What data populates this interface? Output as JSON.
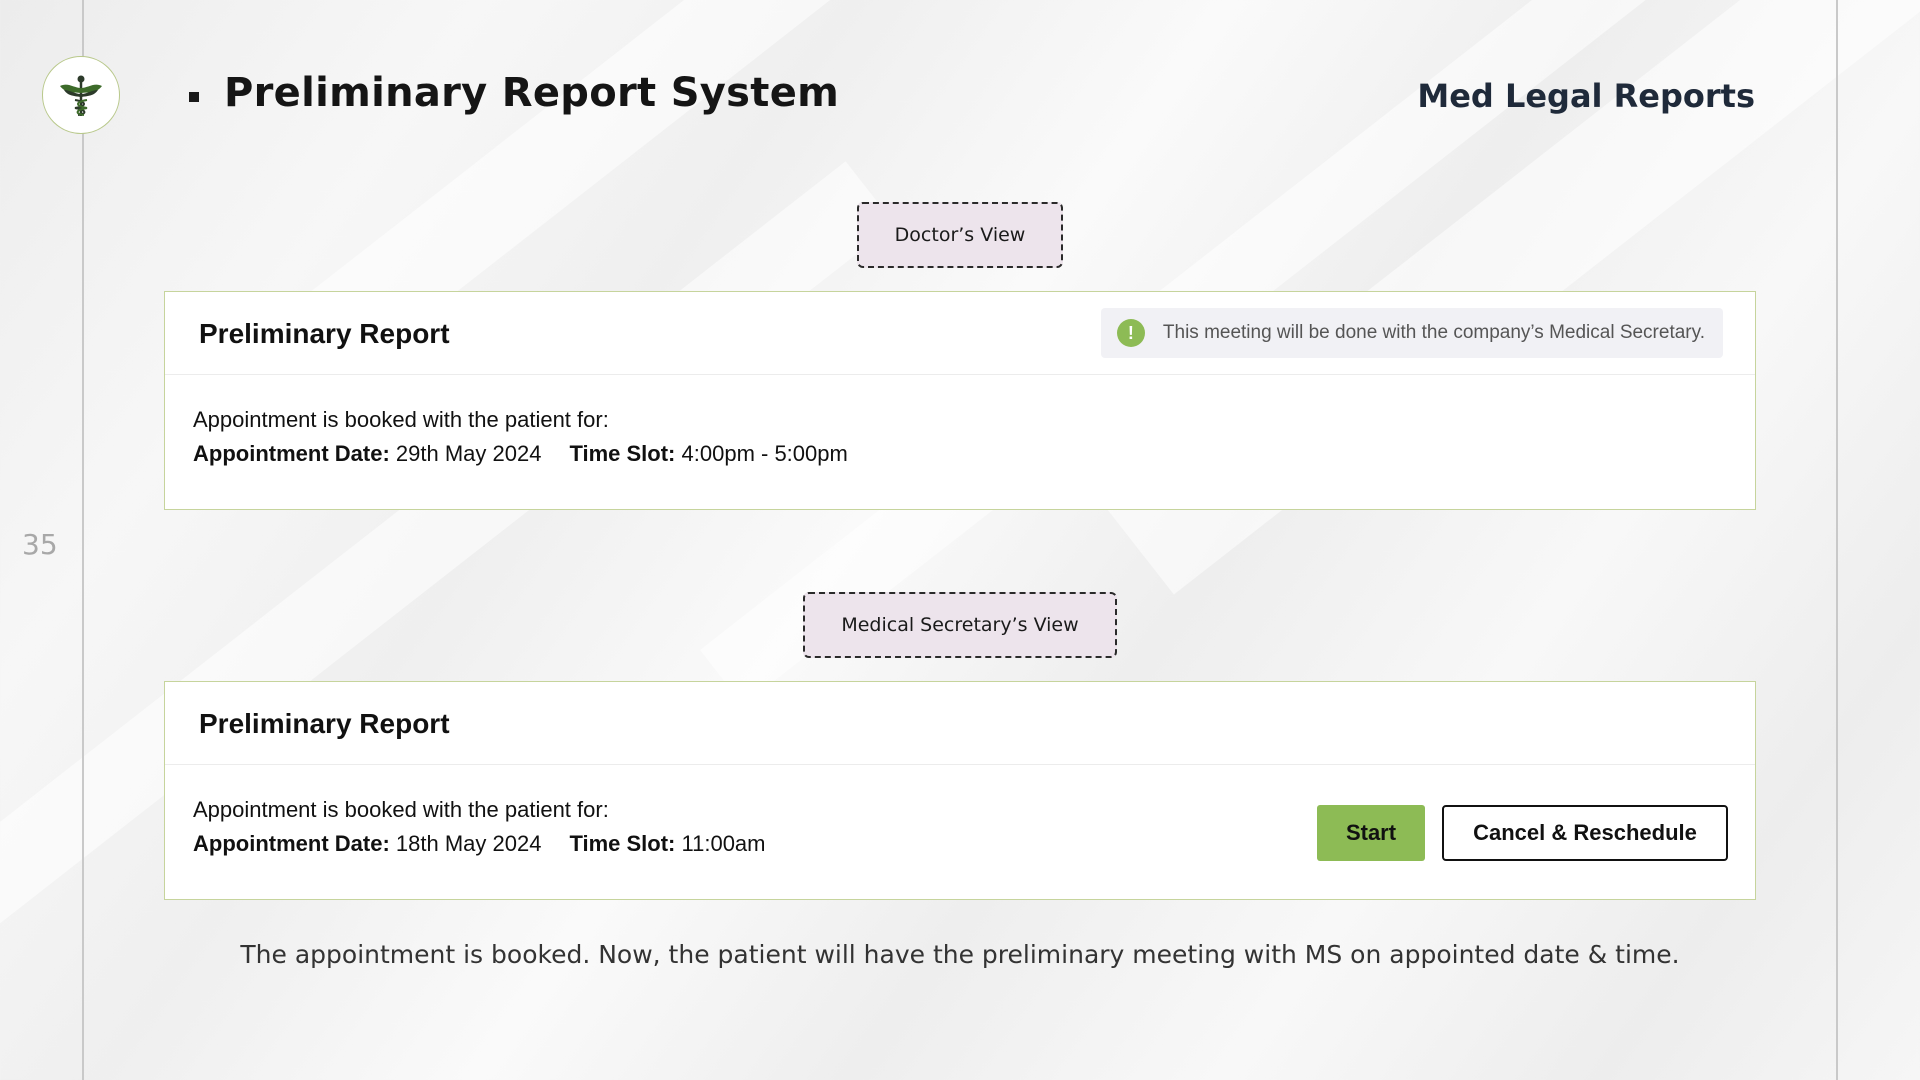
{
  "slide": {
    "number": "35"
  },
  "header": {
    "title": "Preliminary Report System",
    "brand": "Med Legal Reports"
  },
  "doctor_view": {
    "tag": "Doctor’s View",
    "card_title": "Preliminary Report",
    "notice_icon": "!",
    "notice": "This meeting will be done with the company’s Medical Secretary.",
    "booked_text": "Appointment is booked with the patient for:",
    "date_label": "Appointment Date:",
    "date_value": "29th May 2024",
    "slot_label": "Time Slot:",
    "slot_value": "4:00pm - 5:00pm"
  },
  "secretary_view": {
    "tag": "Medical Secretary’s View",
    "card_title": "Preliminary Report",
    "booked_text": "Appointment is booked with the patient for:",
    "date_label": "Appointment Date:",
    "date_value": "18th May 2024",
    "slot_label": "Time Slot:",
    "slot_value": "11:00am",
    "start_label": "Start",
    "cancel_label": "Cancel & Reschedule"
  },
  "footer": {
    "note": "The appointment is booked. Now, the patient will have the preliminary meeting with MS on appointed date & time."
  },
  "colors": {
    "accent_green": "#8dbb55",
    "card_border": "#c6d49c",
    "tag_bg": "#ede4ec",
    "brand_text": "#1f2a3a"
  },
  "icons": {
    "logo": "caduceus-logo",
    "notice": "exclamation-circle-icon"
  }
}
